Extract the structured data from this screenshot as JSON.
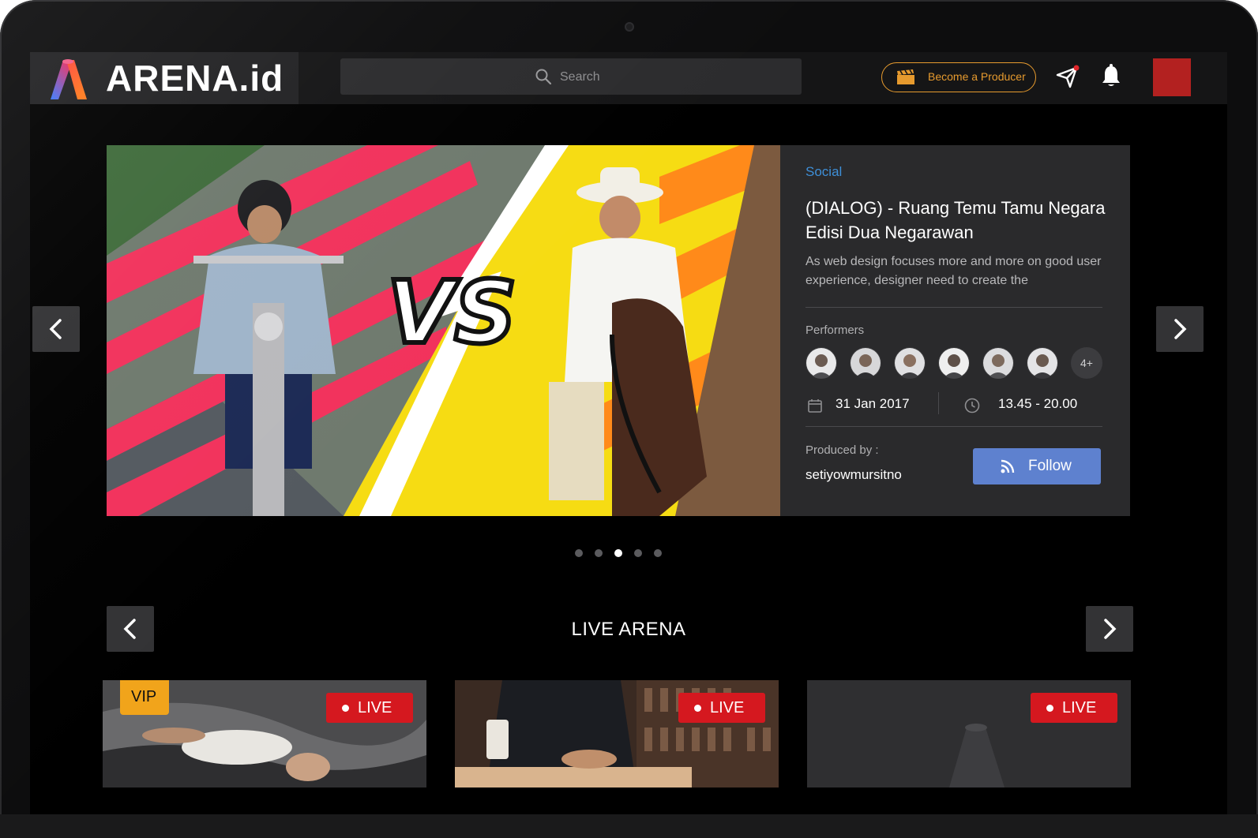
{
  "brand": {
    "name": "ARENA.id"
  },
  "header": {
    "search_placeholder": "Search",
    "producer_button": "Become a Producer"
  },
  "hero": {
    "category": "Social",
    "title": "(DIALOG) - Ruang Temu Tamu Negara Edisi Dua Negarawan",
    "description": "As web design focuses more and more on good user experience, designer need to create the",
    "performers_label": "Performers",
    "performers_count": 6,
    "performers_more": "4+",
    "date": "31 Jan 2017",
    "time": "13.45 - 20.00",
    "produced_by_label": "Produced by :",
    "producer_name": "setiyowmursitno",
    "follow_label": "Follow",
    "slides_total": 5,
    "slide_active": 3
  },
  "live_section": {
    "title": "LIVE ARENA",
    "cards": [
      {
        "vip": "VIP",
        "badge": "LIVE"
      },
      {
        "badge": "LIVE"
      },
      {
        "badge": "LIVE"
      }
    ]
  },
  "colors": {
    "accent_orange": "#e69a2e",
    "live_red": "#d5181f",
    "follow_blue": "#5e81cf",
    "category_blue": "#3e8fd8",
    "avatar_red": "#b32120"
  },
  "icons": [
    "search-icon",
    "clapperboard-icon",
    "send-icon",
    "bell-icon",
    "calendar-icon",
    "clock-icon",
    "rss-icon",
    "chevron-left-icon",
    "chevron-right-icon"
  ]
}
